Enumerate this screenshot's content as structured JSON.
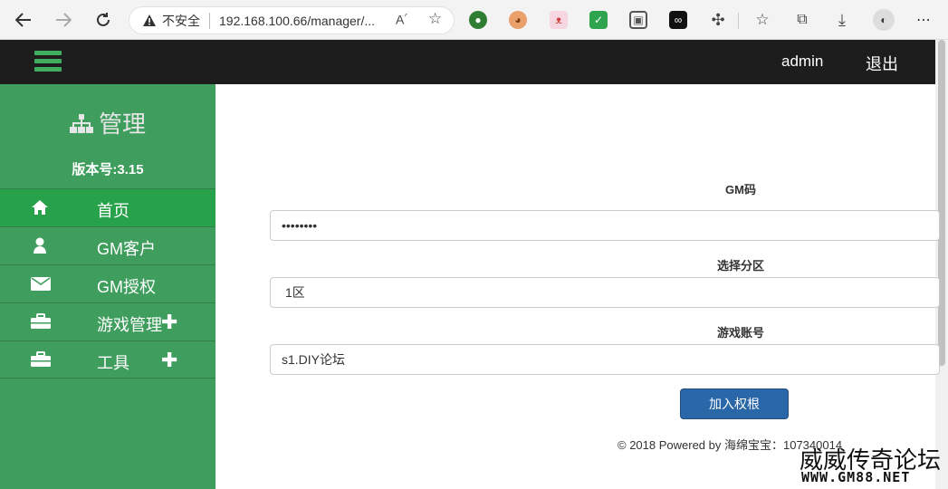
{
  "browser": {
    "insecure_label": "不安全",
    "url": "192.168.100.66/manager/..."
  },
  "topnav": {
    "user": "admin",
    "logout": "退出"
  },
  "sidebar": {
    "brand": "管理",
    "version": "版本号:3.15",
    "items": [
      {
        "label": "首页",
        "icon": "home-icon",
        "active": true
      },
      {
        "label": "GM客户",
        "icon": "user-icon"
      },
      {
        "label": "GM授权",
        "icon": "envelope-icon"
      },
      {
        "label": "游戏管理",
        "icon": "briefcase-icon",
        "plus": "✚"
      },
      {
        "label": "工具",
        "icon": "briefcase-icon",
        "plus": "✚"
      }
    ]
  },
  "form": {
    "gm_code_label": "GM码",
    "gm_code_value": "••••••••",
    "zone_label": "选择分区",
    "zone_value": "1区",
    "account_label": "游戏账号",
    "account_value": "s1.DIY论坛",
    "submit_label": "加入权根"
  },
  "footer": {
    "text": "© 2018 Powered by 海绵宝宝：107340014"
  },
  "watermark": {
    "line1": "威威传奇论坛",
    "line2": "WWW.GM88.NET"
  }
}
